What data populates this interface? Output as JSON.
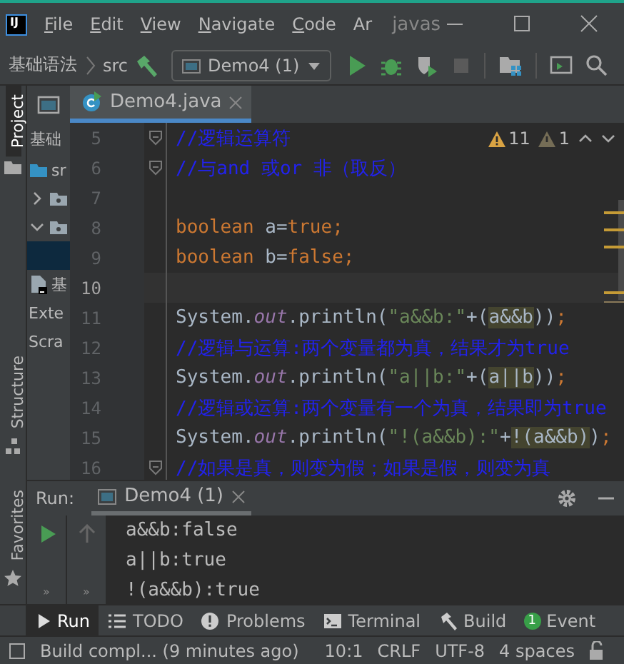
{
  "window": {
    "logo": "IJ",
    "menus": [
      {
        "label": "File",
        "mnemonic": true
      },
      {
        "label": "Edit",
        "mnemonic": true
      },
      {
        "label": "View",
        "mnemonic": true
      },
      {
        "label": "Navigate",
        "mnemonic": true
      },
      {
        "label": "Code",
        "mnemonic": true
      },
      {
        "label": "Ar",
        "mnemonic": false
      }
    ],
    "title": "javas"
  },
  "toolbar": {
    "breadcrumbs": [
      "基础语法",
      "src"
    ],
    "run_config": "Demo4 (1)"
  },
  "side_tabs": [
    {
      "label": "Project",
      "selected": true
    },
    {
      "label": "Structure",
      "selected": false
    },
    {
      "label": "Favorites",
      "selected": false
    }
  ],
  "project": {
    "title": "基础",
    "items": [
      {
        "label": "sr",
        "kind": "folder",
        "selected": false,
        "children": [
          {
            "kind": "package",
            "expanded": false,
            "selected": false
          },
          {
            "kind": "package",
            "expanded": true,
            "selected": false,
            "children": [
              {
                "selected": true
              }
            ]
          }
        ]
      },
      {
        "label": "基",
        "kind": "module",
        "selected": false
      },
      {
        "label": "Exte",
        "selected": false
      },
      {
        "label": "Scra",
        "selected": false
      }
    ]
  },
  "editor": {
    "tab": "Demo4.java",
    "warnings": "11",
    "weak_warnings": "1",
    "lines": [
      {
        "number": "5",
        "fold": true,
        "current": false,
        "tokens": [
          {
            "kind": "comment",
            "text": "//逻辑运算符"
          }
        ]
      },
      {
        "number": "6",
        "fold": true,
        "current": false,
        "tokens": [
          {
            "kind": "comment",
            "text": "//与and 或or 非（取反）"
          }
        ]
      },
      {
        "number": "7",
        "fold": false,
        "current": false
      },
      {
        "number": "8",
        "fold": false,
        "current": false,
        "tokens": [
          {
            "kind": "keyword",
            "text": "boolean"
          },
          {
            "kind": "plain",
            "text": " a="
          },
          {
            "kind": "keyword",
            "text": "true"
          },
          {
            "kind": "punct",
            "text": ";"
          }
        ]
      },
      {
        "number": "9",
        "fold": false,
        "current": false,
        "tokens": [
          {
            "kind": "keyword",
            "text": "boolean"
          },
          {
            "kind": "plain",
            "text": " b="
          },
          {
            "kind": "keyword",
            "text": "false"
          },
          {
            "kind": "punct",
            "text": ";"
          }
        ]
      },
      {
        "number": "10",
        "fold": false,
        "current": true
      },
      {
        "number": "11",
        "fold": false,
        "current": false,
        "tokens": [
          {
            "kind": "plain",
            "text": "System."
          },
          {
            "kind": "field",
            "text": "out"
          },
          {
            "kind": "plain",
            "text": ".println("
          },
          {
            "kind": "string",
            "text": "\"a&&b:\""
          },
          {
            "kind": "plain",
            "text": "+("
          },
          {
            "kind": "match",
            "text": "a&&b"
          },
          {
            "kind": "plain",
            "text": "))"
          },
          {
            "kind": "punct",
            "text": ";"
          }
        ]
      },
      {
        "number": "12",
        "fold": false,
        "current": false,
        "tokens": [
          {
            "kind": "comment",
            "text": "//逻辑与运算:两个变量都为真，结果才为true"
          }
        ]
      },
      {
        "number": "13",
        "fold": false,
        "current": false,
        "tokens": [
          {
            "kind": "plain",
            "text": "System."
          },
          {
            "kind": "field",
            "text": "out"
          },
          {
            "kind": "plain",
            "text": ".println("
          },
          {
            "kind": "string",
            "text": "\"a||b:\""
          },
          {
            "kind": "plain",
            "text": "+("
          },
          {
            "kind": "match",
            "text": "a||b"
          },
          {
            "kind": "plain",
            "text": "))"
          },
          {
            "kind": "punct",
            "text": ";"
          }
        ]
      },
      {
        "number": "14",
        "fold": false,
        "current": false,
        "tokens": [
          {
            "kind": "comment",
            "text": "//逻辑或运算:两个变量有一个为真，结果即为true"
          }
        ]
      },
      {
        "number": "15",
        "fold": false,
        "current": false,
        "tokens": [
          {
            "kind": "plain",
            "text": "System."
          },
          {
            "kind": "field",
            "text": "out"
          },
          {
            "kind": "plain",
            "text": ".println("
          },
          {
            "kind": "string",
            "text": "\"!(a&&b):\""
          },
          {
            "kind": "plain",
            "text": "+"
          },
          {
            "kind": "match",
            "text": "!(a&&b)"
          },
          {
            "kind": "plain",
            "text": ")"
          },
          {
            "kind": "punct",
            "text": ";"
          }
        ]
      },
      {
        "number": "16",
        "fold": true,
        "current": false,
        "tokens": [
          {
            "kind": "comment",
            "text": "//如果是真，则变为假；如果是假，则变为真"
          }
        ]
      }
    ]
  },
  "run": {
    "label": "Run:",
    "tab": "Demo4 (1)",
    "side_buttons": [
      "»",
      "»"
    ],
    "output": [
      "a&&b:false",
      "a||b:true",
      "!(a&&b):true"
    ]
  },
  "tool_tabs": [
    {
      "label": "Run",
      "kind": "play",
      "selected": true
    },
    {
      "label": "TODO",
      "kind": "list",
      "selected": false
    },
    {
      "label": "Problems",
      "kind": "alert",
      "selected": false
    },
    {
      "label": "Terminal",
      "kind": "terminal",
      "selected": false
    },
    {
      "label": "Build",
      "kind": "hammer",
      "selected": false
    },
    {
      "label": "Event",
      "kind": "badge",
      "badge": "1",
      "selected": false
    }
  ],
  "status_bar": {
    "message": "Build compl... (9 minutes ago)",
    "items": [
      "10:1",
      "CRLF",
      "UTF-8",
      "4 spaces"
    ]
  }
}
